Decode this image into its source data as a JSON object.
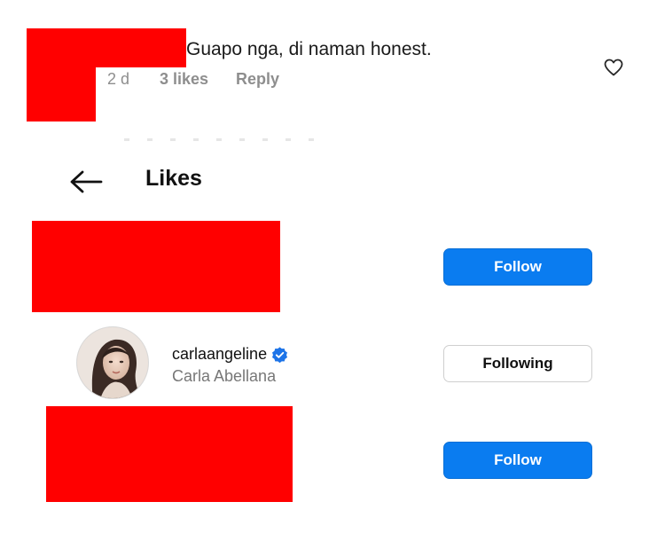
{
  "comment": {
    "text": "Guapo nga, di naman honest.",
    "time": "2 d",
    "likes": "3 likes",
    "reply": "Reply",
    "icon": "heart-icon"
  },
  "header": {
    "title": "Likes",
    "back_icon": "back-arrow-icon"
  },
  "users": [
    {
      "redacted": true,
      "button": "Follow"
    },
    {
      "username": "carlaangeline",
      "fullname": "Carla Abellana",
      "verified": true,
      "button": "Following"
    },
    {
      "redacted": true,
      "button": "Follow"
    }
  ],
  "colors": {
    "accent": "#0a7cf0",
    "redaction": "#ff0000",
    "muted": "#8e8e8e",
    "verified": "#1d74e8"
  }
}
